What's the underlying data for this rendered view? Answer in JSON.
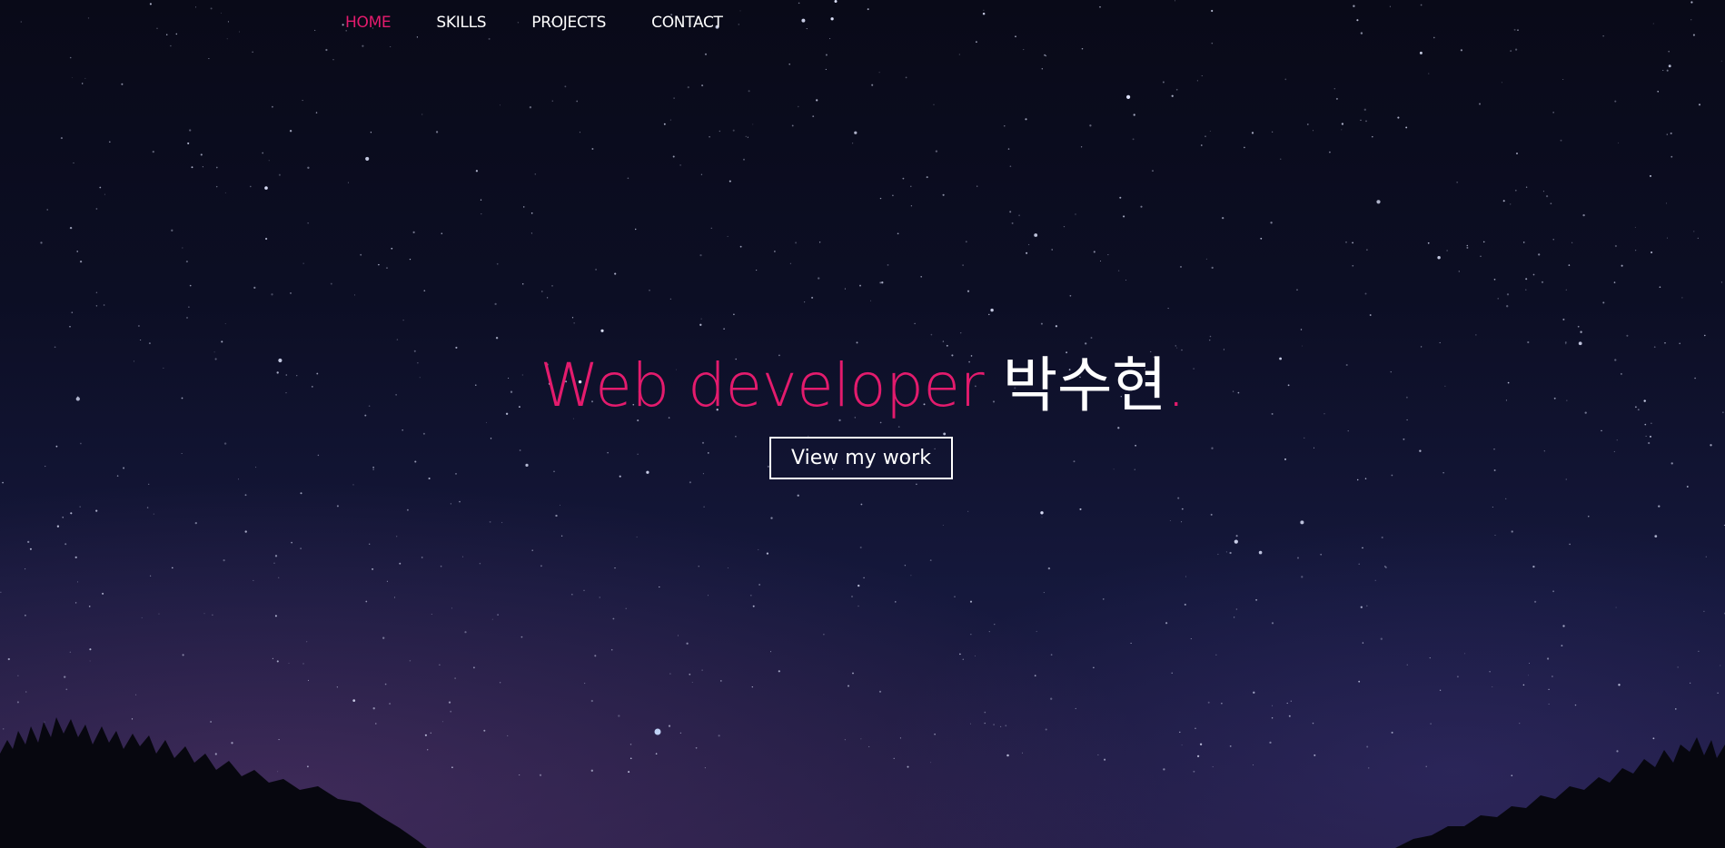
{
  "nav": {
    "items": [
      {
        "label": "HOME",
        "active": true
      },
      {
        "label": "SKILLS",
        "active": false
      },
      {
        "label": "PROJECTS",
        "active": false
      },
      {
        "label": "CONTACT",
        "active": false
      }
    ]
  },
  "hero": {
    "headline_role": "Web developer",
    "headline_name": "박수현",
    "headline_period": ".",
    "cta_label": "View my work"
  },
  "colors": {
    "accent": "#e31b6d",
    "text": "#ffffff",
    "sky_top": "#090a18",
    "sky_bottom": "#231d45"
  }
}
